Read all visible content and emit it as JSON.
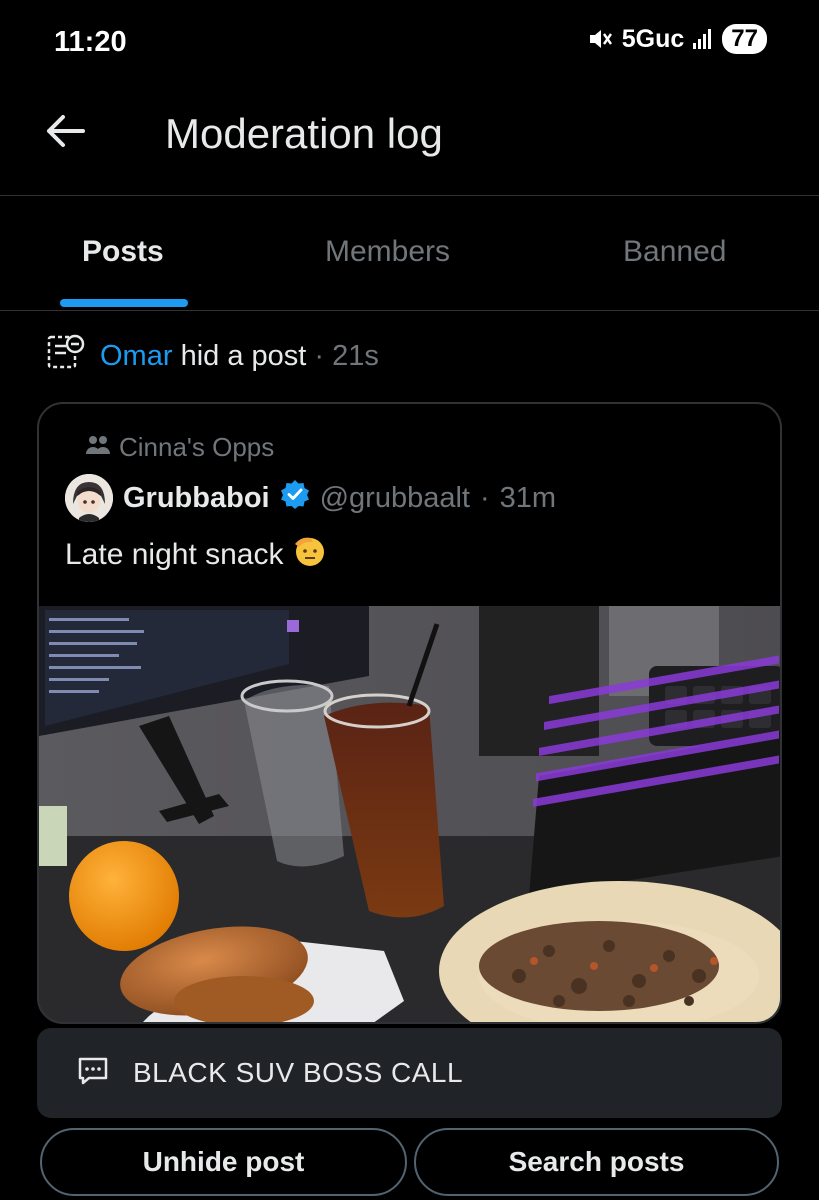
{
  "status_bar": {
    "time": "11:20",
    "network": "5Guc",
    "battery": "77",
    "icons": [
      "mute-icon",
      "signal-icon"
    ]
  },
  "header": {
    "title": "Moderation log",
    "back_icon": "arrow-left-icon"
  },
  "tabs": [
    {
      "label": "Posts",
      "active": true
    },
    {
      "label": "Members",
      "active": false
    },
    {
      "label": "Banned",
      "active": false
    }
  ],
  "log_entry": {
    "actor": "Omar",
    "action": "hid a post",
    "separator": "·",
    "time": "21s",
    "icon": "moderation-log-icon"
  },
  "post": {
    "community": "Cinna's Opps",
    "author_name": "Grubbaboi",
    "verified": true,
    "handle": "@grubbaalt",
    "separator": "·",
    "time": "31m",
    "text": "Late night snack",
    "emoji": "🫡",
    "media_alt": "Photo of a desk with a monitor, keyboard, drinks, an orange, a sandwich and a taco"
  },
  "reason": {
    "icon": "message-dots-icon",
    "text": "BLACK SUV BOSS CALL"
  },
  "actions": {
    "unhide_label": "Unhide post",
    "search_label": "Search posts"
  },
  "colors": {
    "accent": "#1d9bf0",
    "background": "#000000",
    "muted": "#71767b",
    "border": "#2f3336"
  }
}
